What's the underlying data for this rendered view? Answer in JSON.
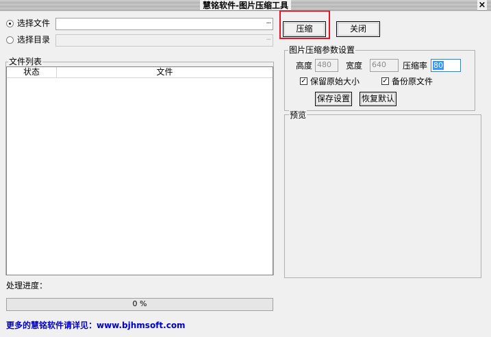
{
  "window": {
    "title": "慧铭软件-图片压缩工具",
    "close_glyph": "×"
  },
  "source": {
    "select_file_label": "选择文件",
    "select_dir_label": "选择目录",
    "selected": "file",
    "file_value": "",
    "dir_value": "",
    "browse_glyph": "···"
  },
  "file_list": {
    "group_label": "文件列表",
    "columns": [
      "状态",
      "文件"
    ],
    "rows": []
  },
  "actions": {
    "compress_label": "压缩",
    "close_label": "关闭"
  },
  "params": {
    "group_label": "图片压缩参数设置",
    "height_label": "高度",
    "height_value": "480",
    "width_label": "宽度",
    "width_value": "640",
    "ratio_label": "压缩率",
    "ratio_value": "80",
    "keep_size_label": "保留原始大小",
    "keep_size_checked": true,
    "backup_label": "备份原文件",
    "backup_checked": true,
    "save_label": "保存设置",
    "restore_label": "恢复默认"
  },
  "preview": {
    "group_label": "预览"
  },
  "progress": {
    "label": "处理进度：",
    "value_text": "0 %",
    "fraction": 0
  },
  "footer": {
    "text": "更多的慧铭软件请详见：www.bjhmsoft.com"
  },
  "colors": {
    "highlight": "#e81123",
    "link": "#0000cc",
    "selection": "#3399ff"
  }
}
